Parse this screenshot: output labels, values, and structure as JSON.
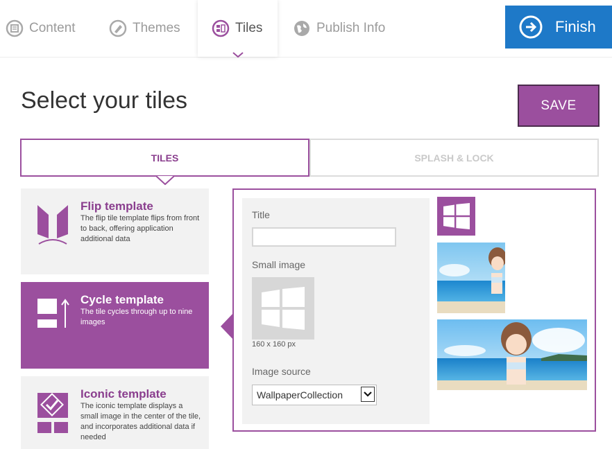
{
  "nav": {
    "tabs": [
      {
        "label": "Content",
        "icon": "content-icon"
      },
      {
        "label": "Themes",
        "icon": "themes-icon"
      },
      {
        "label": "Tiles",
        "icon": "tiles-icon",
        "active": true
      },
      {
        "label": "Publish Info",
        "icon": "globe-icon"
      }
    ],
    "finish_label": "Finish"
  },
  "page": {
    "title": "Select your tiles",
    "save_label": "SAVE"
  },
  "subtabs": {
    "tiles": "TILES",
    "splash": "SPLASH & LOCK"
  },
  "templates": [
    {
      "title": "Flip template",
      "desc": "The flip tile template flips from front to back, offering application additional data",
      "icon": "flip-template-icon"
    },
    {
      "title": "Cycle template",
      "desc": "The tile cycles through up to nine images",
      "icon": "cycle-template-icon",
      "active": true
    },
    {
      "title": "Iconic template",
      "desc": "The iconic template displays a small image in the center of the tile, and incorporates additional data if needed",
      "icon": "iconic-template-icon"
    }
  ],
  "form": {
    "title_label": "Title",
    "title_value": "",
    "small_image_label": "Small image",
    "small_image_size": "160 x 160 px",
    "image_source_label": "Image source",
    "image_source_value": "WallpaperCollection"
  },
  "colors": {
    "accent": "#9b4f9e",
    "finish": "#1e79c8",
    "panel_bg": "#f2f2f2"
  }
}
